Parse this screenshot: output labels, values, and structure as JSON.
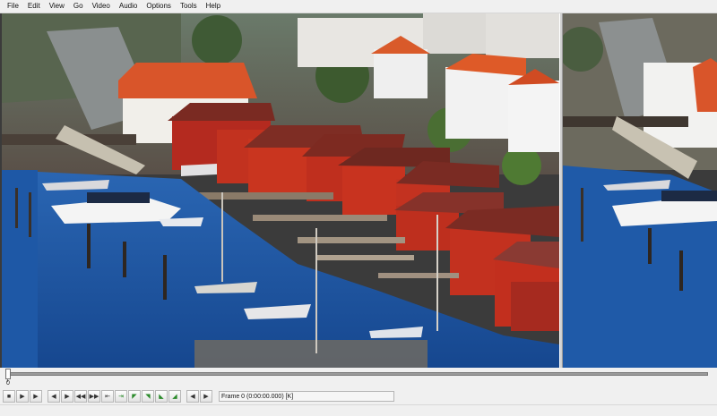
{
  "menu": {
    "items": [
      "File",
      "Edit",
      "View",
      "Go",
      "Video",
      "Audio",
      "Options",
      "Tools",
      "Help"
    ]
  },
  "seek": {
    "position_label": "0",
    "progress": 0
  },
  "toolbar": {
    "buttons": [
      {
        "icon": "stop-icon",
        "glyph": "■"
      },
      {
        "icon": "play-input-icon",
        "glyph": "▶"
      },
      {
        "icon": "play-output-icon",
        "glyph": "▶"
      },
      {
        "icon": "prev-frame-icon",
        "glyph": "◀"
      },
      {
        "icon": "next-frame-icon",
        "glyph": "▶"
      },
      {
        "icon": "prev-key-icon",
        "glyph": "◀◀"
      },
      {
        "icon": "next-key-icon",
        "glyph": "▶▶"
      },
      {
        "icon": "scene-back-icon",
        "glyph": "⇤"
      },
      {
        "icon": "scene-forward-icon",
        "glyph": "⇥"
      },
      {
        "icon": "mark-in-icon",
        "glyph": "◤"
      },
      {
        "icon": "mark-out-icon",
        "glyph": "◥"
      },
      {
        "icon": "mark-start-icon",
        "glyph": "◣"
      },
      {
        "icon": "mark-end-icon",
        "glyph": "◢"
      },
      {
        "icon": "rewind-icon",
        "glyph": "◀"
      },
      {
        "icon": "forward-icon",
        "glyph": "▶"
      }
    ],
    "frame_readout": "Frame 0 (0:00:00.000) [K]"
  },
  "colors": {
    "water": "#1f5aa8",
    "house_red": "#b5281e",
    "roof_orange": "#e0501e",
    "background": "#f0f0f0"
  }
}
